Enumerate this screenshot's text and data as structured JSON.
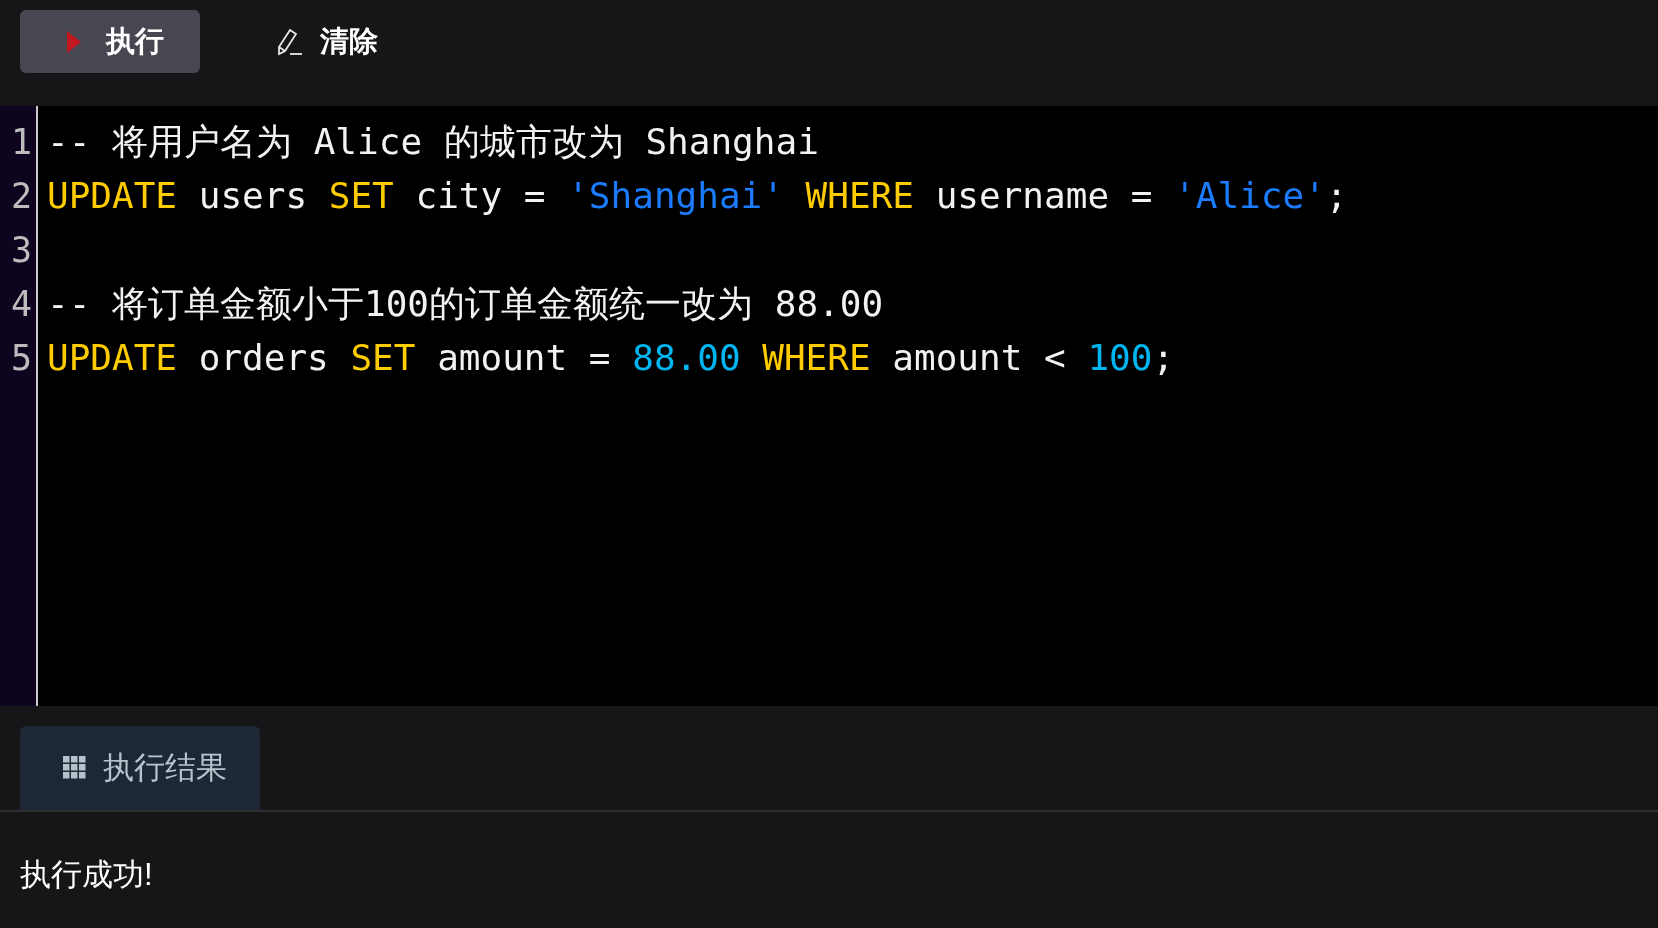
{
  "toolbar": {
    "buttons": [
      {
        "kind": "run",
        "label": "执行"
      },
      {
        "kind": "clear",
        "label": "清除"
      }
    ]
  },
  "editor": {
    "lines": [
      {
        "number": "1",
        "tokens": [
          {
            "kind": "comment",
            "text": "-- 将用户名为 Alice 的城市改为 Shanghai"
          }
        ]
      },
      {
        "number": "2",
        "tokens": [
          {
            "kind": "keyword",
            "text": "UPDATE"
          },
          {
            "kind": "plain",
            "text": " users "
          },
          {
            "kind": "keyword",
            "text": "SET"
          },
          {
            "kind": "plain",
            "text": " city = "
          },
          {
            "kind": "string",
            "text": "'Shanghai'"
          },
          {
            "kind": "keyword",
            "text": " WHERE"
          },
          {
            "kind": "plain",
            "text": " username = "
          },
          {
            "kind": "string",
            "text": "'Alice'"
          },
          {
            "kind": "plain",
            "text": ";"
          }
        ]
      },
      {
        "number": "3"
      },
      {
        "number": "4",
        "tokens": [
          {
            "kind": "comment",
            "text": "-- 将订单金额小于100的订单金额统一改为 88.00"
          }
        ]
      },
      {
        "number": "5",
        "tokens": [
          {
            "kind": "keyword",
            "text": "UPDATE"
          },
          {
            "kind": "plain",
            "text": " orders "
          },
          {
            "kind": "keyword",
            "text": "SET"
          },
          {
            "kind": "plain",
            "text": " amount = "
          },
          {
            "kind": "number",
            "text": "88.00"
          },
          {
            "kind": "keyword",
            "text": " WHERE"
          },
          {
            "kind": "plain",
            "text": " amount < "
          },
          {
            "kind": "number",
            "text": "100"
          },
          {
            "kind": "plain",
            "text": ";"
          }
        ]
      }
    ]
  },
  "results": {
    "tabs": [
      {
        "label": "执行结果",
        "selected": true
      }
    ],
    "message": "执行成功!"
  }
}
